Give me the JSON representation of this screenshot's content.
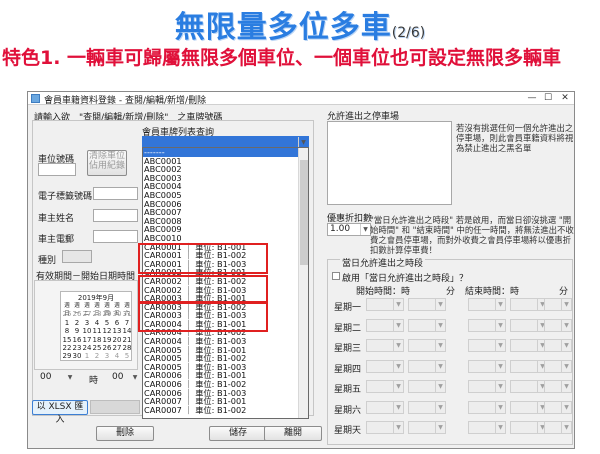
{
  "slide": {
    "title": "無限量多位多車",
    "page": "(2/6)",
    "subtitle": "特色1. 一輛車可歸屬無限多個車位、一個車位也可設定無限多輛車"
  },
  "window": {
    "title": "會員車籍資料登錄 - 查閱/編輯/新增/刪除",
    "min_label": "—",
    "max_label": "☐",
    "close_label": "✕"
  },
  "left": {
    "intro": "請輸入欲　\"查閱/編輯/新增/刪除\"　之車牌號碼",
    "list_label": "會員車牌列表查詢",
    "combo_value": "",
    "slot_label": "車位號碼",
    "clear_button": "清除車位\n佔用紀錄",
    "etag_label": "電子標籤號碼",
    "owner_label": "車主姓名",
    "phone_label": "車主電郵",
    "type_label": "種別",
    "period_label": "有效期間－開始日期時間",
    "calendar": {
      "header": "2019年9月",
      "rows": [
        [
          "週日",
          "週一",
          "週二",
          "週三",
          "週四",
          "週五",
          "週六"
        ],
        [
          "25",
          "26",
          "27",
          "28",
          "29",
          "30",
          "31"
        ],
        [
          "1",
          "2",
          "3",
          "4",
          "5",
          "6",
          "7"
        ],
        [
          "8",
          "9",
          "10",
          "11",
          "12",
          "13",
          "14"
        ],
        [
          "15",
          "16",
          "17",
          "18",
          "19",
          "20",
          "21"
        ],
        [
          "22",
          "23",
          "24",
          "25",
          "26",
          "27",
          "28"
        ],
        [
          "29",
          "30",
          "1",
          "2",
          "3",
          "4",
          "5"
        ]
      ]
    },
    "hour_value": "00",
    "hour_unit": "時",
    "min_value": "00",
    "import_button": "以 XLSX 匯入"
  },
  "dropdown": {
    "items": [
      "-------",
      "ABC0001",
      "ABC0002",
      "ABC0003",
      "ABC0004",
      "ABC0005",
      "ABC0006",
      "ABC0007",
      "ABC0008",
      "ABC0009",
      "ABC0010",
      "CAR0001 ｜ 車位: B1-001",
      "CAR0001 ｜ 車位: B1-002",
      "CAR0001 ｜ 車位: B1-003",
      "CAR0002 ｜ 車位: B1-001",
      "CAR0002 ｜ 車位: B1-002",
      "CAR0002 ｜ 車位: B1-003",
      "CAR0003 ｜ 車位: B1-001",
      "CAR0003 ｜ 車位: B1-002",
      "CAR0003 ｜ 車位: B1-003",
      "CAR0004 ｜ 車位: B1-001",
      "CAR0004 ｜ 車位: B1-002",
      "CAR0004 ｜ 車位: B1-003",
      "CAR0005 ｜ 車位: B1-001",
      "CAR0005 ｜ 車位: B1-002",
      "CAR0005 ｜ 車位: B1-003",
      "CAR0006 ｜ 車位: B1-001",
      "CAR0006 ｜ 車位: B1-002",
      "CAR0006 ｜ 車位: B1-003",
      "CAR0007 ｜ 車位: B1-001",
      "CAR0007 ｜ 車位: B1-002"
    ]
  },
  "right": {
    "allowed_label": "允許進出之停車場",
    "allowed_note": "若沒有挑選任何一個允許進出之停車場，則此會員車籍資料將視為禁止進出之黑名單",
    "discount_label": "優惠折扣數",
    "discount_value": "1.00",
    "discount_note": "\"當日允許進出之時段\" 若是啟用，而當日卻沒挑選 \"開始時間\" 和 \"結束時間\" 中的任一時間，將無法進出不收費之會員停車場，而對外收費之會員停車場將以優惠折扣數計算停車費！",
    "period_group": "當日允許進出之時段",
    "enable_label": "啟用「當日允許進出之時段」？",
    "start_label": "開始時間：時",
    "min_label": "分",
    "end_label": "結束時間：時",
    "end_min_label": "分",
    "days": [
      "星期一",
      "星期二",
      "星期三",
      "星期四",
      "星期五",
      "星期六",
      "星期天"
    ]
  },
  "buttons": {
    "delete": "刪除",
    "save": "儲存",
    "leave": "離開"
  },
  "colors": {
    "title": "#2a7de1",
    "subtitle": "#e0103a",
    "highlight": "#e02020",
    "selected": "#3275d8"
  }
}
